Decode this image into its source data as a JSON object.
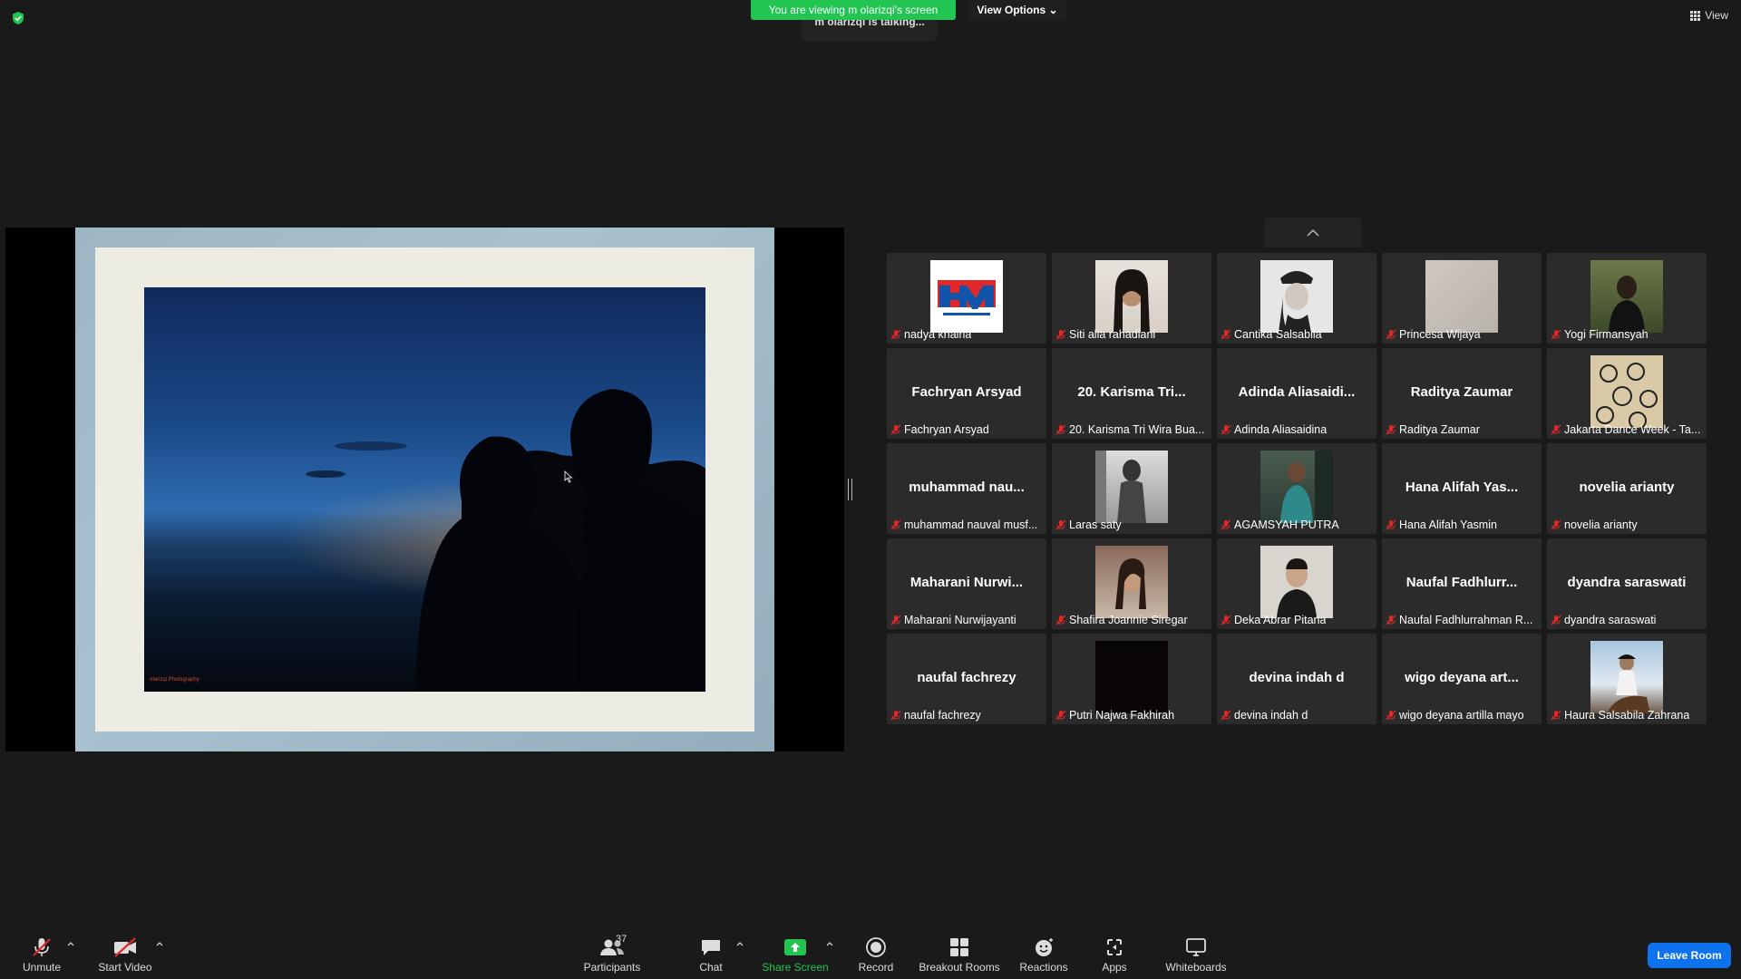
{
  "banner": {
    "viewing_text": "You are viewing m olarizqi's screen",
    "view_options_label": "View Options"
  },
  "talking_indicator": "m olarizqi is talking...",
  "top_view_label": "View",
  "shared_photo": {
    "watermark": "olarizqi Photography"
  },
  "participants": [
    {
      "name": "nadya khairia",
      "tile_label": "",
      "has_video": true
    },
    {
      "name": "Siti alia rahadiani",
      "tile_label": "",
      "has_video": true
    },
    {
      "name": "Cantika Salsabila",
      "tile_label": "",
      "has_video": true
    },
    {
      "name": "Princesa Wijaya",
      "tile_label": "",
      "has_video": true
    },
    {
      "name": "Yogi Firmansyah",
      "tile_label": "",
      "has_video": true
    },
    {
      "name": "Fachryan Arsyad",
      "tile_label": "Fachryan Arsyad",
      "has_video": false
    },
    {
      "name": "20. Karisma Tri Wira Bua...",
      "tile_label": "20. Karisma Tri...",
      "has_video": false
    },
    {
      "name": "Adinda Aliasaidina",
      "tile_label": "Adinda  Aliasaidi...",
      "has_video": false
    },
    {
      "name": "Raditya Zaumar",
      "tile_label": "Raditya Zaumar",
      "has_video": false
    },
    {
      "name": "Jakarta Dance Week - Ta...",
      "tile_label": "",
      "has_video": true
    },
    {
      "name": "muhammad nauval musf...",
      "tile_label": "muhammad  nau...",
      "has_video": false
    },
    {
      "name": "Laras saty",
      "tile_label": "",
      "has_video": true
    },
    {
      "name": "AGAMSYAH PUTRA",
      "tile_label": "",
      "has_video": true
    },
    {
      "name": "Hana Alifah Yasmin",
      "tile_label": "Hana Alifah Yas...",
      "has_video": false
    },
    {
      "name": "novelia arianty",
      "tile_label": "novelia arianty",
      "has_video": false
    },
    {
      "name": "Maharani Nurwijayanti",
      "tile_label": "Maharani  Nurwi...",
      "has_video": false
    },
    {
      "name": "Shafira Joannie Siregar",
      "tile_label": "",
      "has_video": true
    },
    {
      "name": "Deka Abrar Pitana",
      "tile_label": "",
      "has_video": true
    },
    {
      "name": "Naufal Fadhlurrahman R...",
      "tile_label": "Naufal  Fadhlurr...",
      "has_video": false
    },
    {
      "name": "dyandra saraswati",
      "tile_label": "dyandra saraswati",
      "has_video": false
    },
    {
      "name": "naufal fachrezy",
      "tile_label": "naufal fachrezy",
      "has_video": false
    },
    {
      "name": "Putri Najwa Fakhirah",
      "tile_label": "",
      "has_video": true
    },
    {
      "name": "devina indah d",
      "tile_label": "devina indah d",
      "has_video": false
    },
    {
      "name": "wigo deyana artilla mayo",
      "tile_label": "wigo  deyana  art...",
      "has_video": false
    },
    {
      "name": "Haura Salsabila Zahrana",
      "tile_label": "",
      "has_video": true
    }
  ],
  "toolbar": {
    "unmute_label": "Unmute",
    "start_video_label": "Start Video",
    "participants_label": "Participants",
    "participants_count": "37",
    "chat_label": "Chat",
    "share_screen_label": "Share Screen",
    "record_label": "Record",
    "breakout_label": "Breakout Rooms",
    "reactions_label": "Reactions",
    "apps_label": "Apps",
    "whiteboards_label": "Whiteboards",
    "leave_label": "Leave Room"
  },
  "colors": {
    "banner_green": "#23c552",
    "leave_blue": "#0e72ed",
    "share_green": "#23c552",
    "muted_red": "#e02828"
  }
}
